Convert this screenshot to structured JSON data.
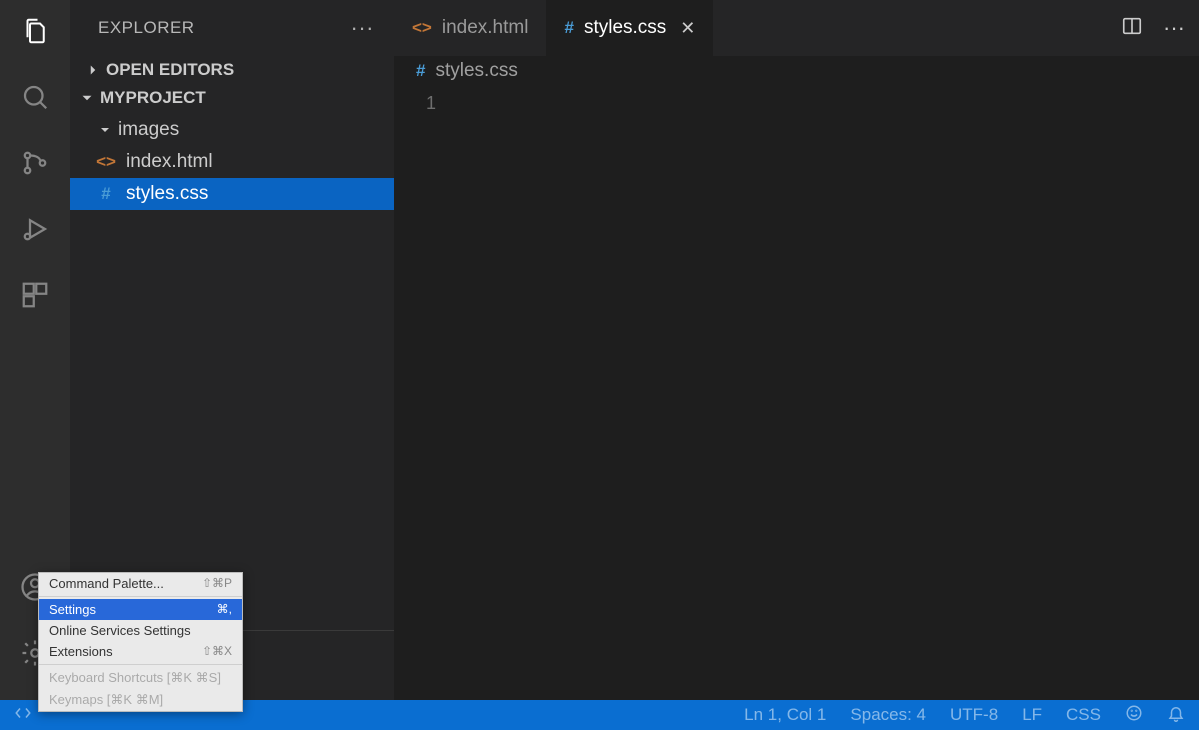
{
  "sidebar": {
    "title": "EXPLORER",
    "openEditorsLabel": "OPEN EDITORS",
    "projectLabel": "MYPROJECT",
    "tree": {
      "images": "images",
      "indexHtml": "index.html",
      "stylesCss": "styles.css"
    }
  },
  "tabs": {
    "indexHtml": "index.html",
    "stylesCss": "styles.css"
  },
  "breadcrumb": {
    "file": "styles.css"
  },
  "editor": {
    "lineNumber": "1"
  },
  "contextMenu": {
    "commandPalette": "Command Palette...",
    "commandPaletteShortcut": "⇧⌘P",
    "settings": "Settings",
    "settingsShortcut": "⌘,",
    "onlineServices": "Online Services Settings",
    "extensions": "Extensions",
    "extensionsShortcut": "⇧⌘X",
    "keyboardShortcuts": "Keyboard Shortcuts [⌘K ⌘S]",
    "keymaps": "Keymaps [⌘K ⌘M]"
  },
  "status": {
    "lineCol": "Ln 1, Col 1",
    "spaces": "Spaces: 4",
    "encoding": "UTF-8",
    "eol": "LF",
    "language": "CSS"
  },
  "icons": {
    "htmlGlyph": "<>",
    "cssGlyph": "#"
  }
}
